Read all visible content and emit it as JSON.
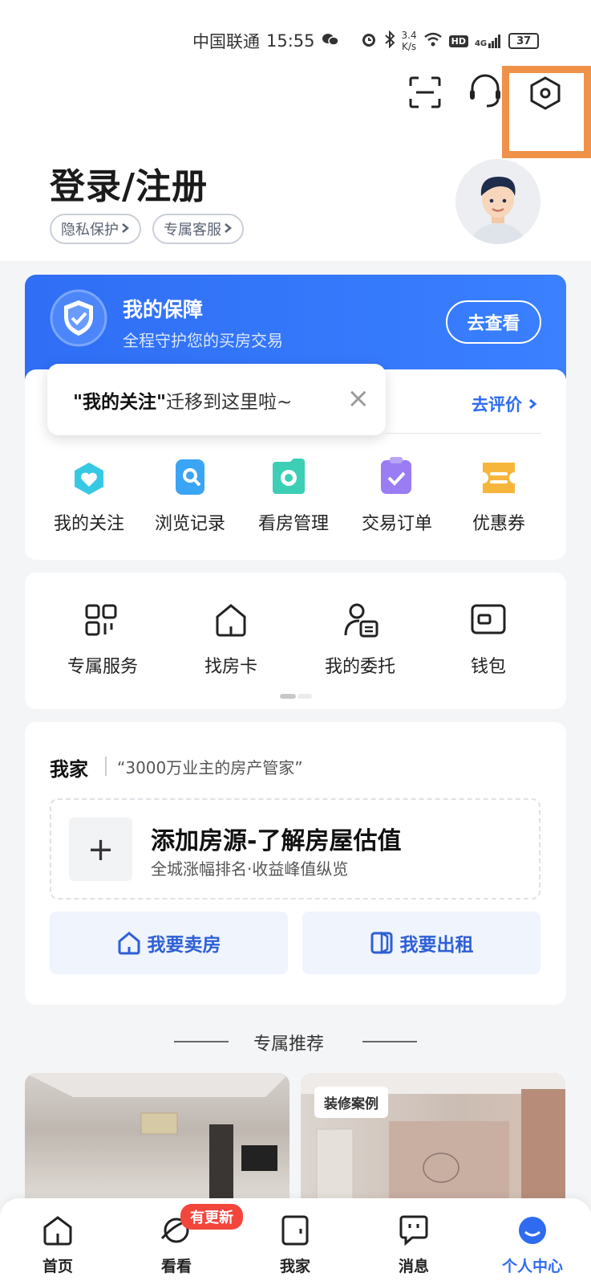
{
  "status_bar": {
    "carrier": "中国联通",
    "time": "15:55",
    "net_speed_value": "3.4",
    "net_speed_unit": "K/s",
    "hd_label": "HD",
    "network_label": "4G",
    "battery": "37"
  },
  "header": {
    "title": "登录/注册",
    "pills": [
      "隐私保护",
      "专属客服"
    ]
  },
  "protection": {
    "title": "我的保障",
    "subtitle": "全程守护您的买房交易",
    "button": "去查看"
  },
  "tooltip": {
    "quoted": "\"我的关注\"",
    "message": "迁移到这里啦~",
    "close": "×"
  },
  "review_link": "去评价",
  "quick_actions": [
    {
      "label": "我的关注",
      "icon": "heart-icon",
      "color": "#37c9e3"
    },
    {
      "label": "浏览记录",
      "icon": "search-history-icon",
      "color": "#3aa4f5"
    },
    {
      "label": "看房管理",
      "icon": "camera-icon",
      "color": "#3ccfb5"
    },
    {
      "label": "交易订单",
      "icon": "clipboard-check-icon",
      "color": "#9a7cf3"
    },
    {
      "label": "优惠券",
      "icon": "ticket-icon",
      "color": "#f6b63c"
    }
  ],
  "services": [
    {
      "label": "专属服务",
      "icon": "grid-icon"
    },
    {
      "label": "找房卡",
      "icon": "house-icon"
    },
    {
      "label": "我的委托",
      "icon": "person-document-icon"
    },
    {
      "label": "钱包",
      "icon": "wallet-icon"
    }
  ],
  "my_home": {
    "title": "我家",
    "tagline": "“3000万业主的房产管家”",
    "add_title": "添加房源-了解房屋估值",
    "add_sub": "全城涨幅排名·收益峰值纵览",
    "plus": "+",
    "sell": "我要卖房",
    "rent": "我要出租"
  },
  "recommend": {
    "title": "专属推荐",
    "tag": "装修案例"
  },
  "bottom_nav": {
    "items": [
      "首页",
      "看看",
      "我家",
      "消息",
      "个人中心"
    ],
    "badge": "有更新",
    "active_color": "#2e6bf0"
  },
  "colors": {
    "brand_blue": "#2f6ef5",
    "highlight": "#f0914a",
    "badge_red": "#f2463d"
  }
}
